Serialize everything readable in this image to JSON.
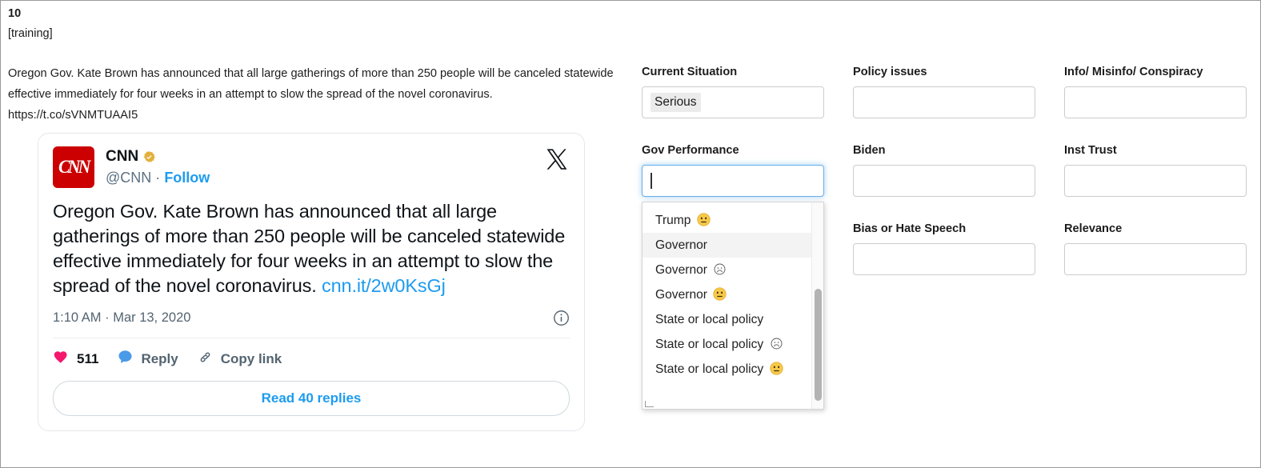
{
  "item": {
    "number": "10",
    "split": "[training]",
    "raw_text": "Oregon Gov. Kate Brown has announced that all large gatherings of more than 250 people will be canceled statewide effective immediately for four weeks in an attempt to slow the spread of the novel coronavirus. https://t.co/sVNMTUAAI5"
  },
  "tweet": {
    "avatar_text": "CNN",
    "display_name": "CNN",
    "handle": "@CNN",
    "separator": "·",
    "follow_label": "Follow",
    "body_text": "Oregon Gov. Kate Brown has announced that all large gatherings of more than 250 people will be canceled statewide effective immediately for four weeks in an attempt to slow the spread of the novel coronavirus.",
    "body_link": "cnn.it/2w0KsGj",
    "timestamp": "1:10 AM · Mar 13, 2020",
    "like_count": "511",
    "reply_label": "Reply",
    "copy_link_label": "Copy link",
    "read_replies_label": "Read 40 replies",
    "icons": {
      "platform": "x-logo-icon",
      "verified": "verified-badge-icon",
      "info": "info-circle-icon",
      "like": "heart-icon",
      "reply": "speech-bubble-icon",
      "copy_link": "link-chain-icon"
    }
  },
  "form": {
    "fields": [
      {
        "label": "Current Situation",
        "value": "Serious",
        "focused": false
      },
      {
        "label": "Policy issues",
        "value": "",
        "focused": false
      },
      {
        "label": "Info/ Misinfo/ Conspiracy",
        "value": "",
        "focused": false
      },
      {
        "label": "Gov Performance",
        "value": "",
        "focused": true
      },
      {
        "label": "Biden",
        "value": "",
        "focused": false
      },
      {
        "label": "Inst Trust",
        "value": "",
        "focused": false
      },
      {
        "label": "Bias or Hate Speech",
        "value": "",
        "focused": false
      },
      {
        "label": "Relevance",
        "value": "",
        "focused": false
      }
    ]
  },
  "dropdown": {
    "open_for_field": "Gov Performance",
    "options": [
      {
        "text": "Trump",
        "emoji": "neutral-face",
        "active": false
      },
      {
        "text": "Governor",
        "emoji": "",
        "active": true
      },
      {
        "text": "Governor",
        "emoji": "frowning-face",
        "active": false
      },
      {
        "text": "Governor",
        "emoji": "neutral-face",
        "active": false
      },
      {
        "text": "State or local policy",
        "emoji": "",
        "active": false
      },
      {
        "text": "State or local policy",
        "emoji": "frowning-face",
        "active": false
      },
      {
        "text": "State or local policy",
        "emoji": "neutral-face",
        "active": false
      }
    ]
  },
  "colors": {
    "accent_blue": "#1d9bf0",
    "focus_blue": "#66afe9",
    "cnn_red": "#cc0000",
    "heart_pink": "#f4176d",
    "reply_blue": "#4a9ae8",
    "verified_gold": "#e2b13c",
    "chip_gray": "#ebebeb"
  }
}
